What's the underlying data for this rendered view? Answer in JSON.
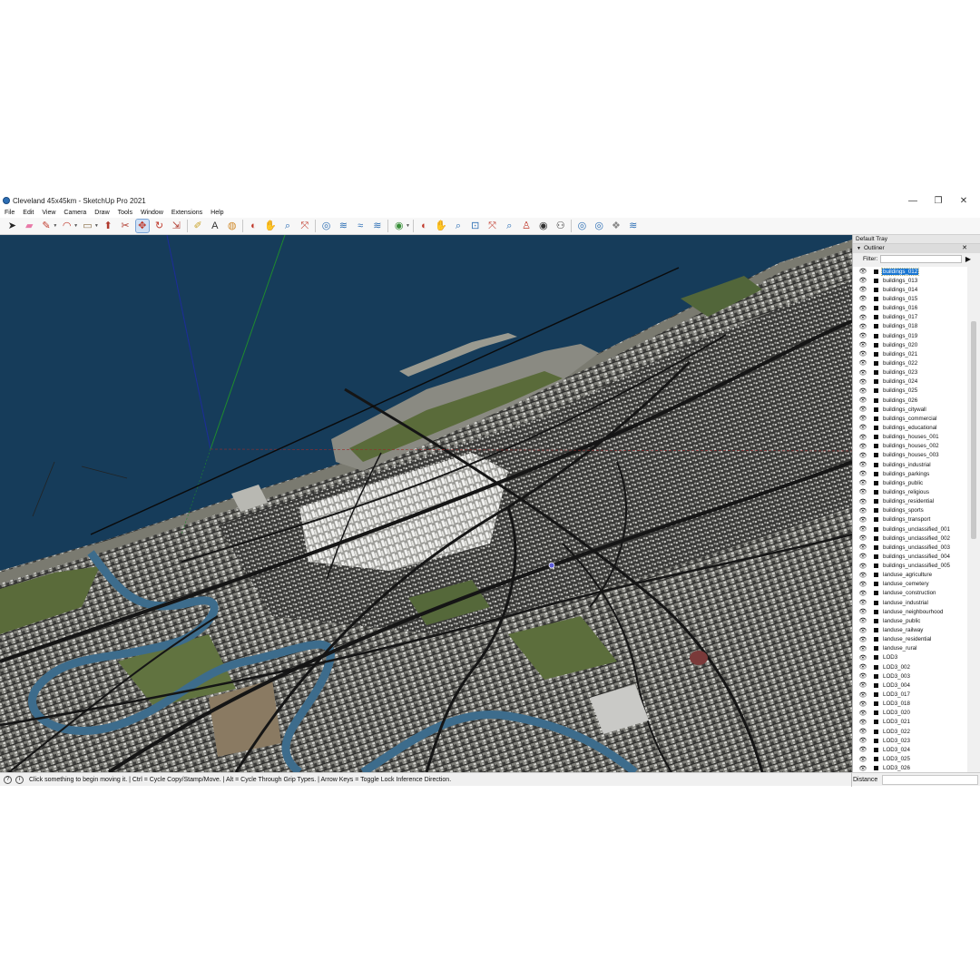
{
  "window": {
    "title": "Cleveland 45x45km - SketchUp Pro 2021",
    "minimize": "—",
    "maximize": "❐",
    "close": "✕"
  },
  "menu": [
    "File",
    "Edit",
    "View",
    "Camera",
    "Draw",
    "Tools",
    "Window",
    "Extensions",
    "Help"
  ],
  "toolbar": {
    "tools": [
      {
        "name": "select-icon",
        "glyph": "➤",
        "color": "#222"
      },
      {
        "name": "eraser-icon",
        "glyph": "▰",
        "color": "#e87aa8"
      },
      {
        "name": "pencil-icon",
        "glyph": "✎",
        "color": "#c0392b",
        "caret": true
      },
      {
        "name": "arc-icon",
        "glyph": "◠",
        "color": "#c0392b",
        "caret": true
      },
      {
        "name": "rectangle-icon",
        "glyph": "▭",
        "color": "#8a6f47",
        "caret": true
      },
      {
        "name": "push-pull-icon",
        "glyph": "⬆",
        "color": "#b03a2e"
      },
      {
        "name": "follow-me-icon",
        "glyph": "✂",
        "color": "#b03a2e"
      },
      {
        "name": "move-icon",
        "glyph": "✥",
        "color": "#c0392b",
        "active": true
      },
      {
        "name": "rotate-icon",
        "glyph": "↻",
        "color": "#c0392b"
      },
      {
        "name": "scale-icon",
        "glyph": "⇲",
        "color": "#b03a2e"
      },
      {
        "name": "tape-measure-icon",
        "glyph": "✐",
        "color": "#c9a227",
        "sep": true
      },
      {
        "name": "text-icon",
        "glyph": "A",
        "color": "#333"
      },
      {
        "name": "paint-bucket-icon",
        "glyph": "◍",
        "color": "#d08a2a"
      },
      {
        "name": "orbit-icon",
        "glyph": "◐",
        "color": "#c0392b",
        "sep": true
      },
      {
        "name": "pan-icon",
        "glyph": "✋",
        "color": "#d2a16b"
      },
      {
        "name": "zoom-icon",
        "glyph": "⌕",
        "color": "#2d6fb5"
      },
      {
        "name": "zoom-extents-icon",
        "glyph": "⤧",
        "color": "#c0392b"
      },
      {
        "name": "warehouse-icon",
        "glyph": "◎",
        "color": "#2d6fb5",
        "sep": true
      },
      {
        "name": "extension-warehouse-icon",
        "glyph": "≋",
        "color": "#2d6fb5"
      },
      {
        "name": "send-to-layout-icon",
        "glyph": "≈",
        "color": "#2d6fb5"
      },
      {
        "name": "extension-manager-icon",
        "glyph": "≋",
        "color": "#2d6fb5"
      },
      {
        "name": "account-icon",
        "glyph": "◉",
        "color": "#3a8f3a",
        "caret": true,
        "sep": true
      },
      {
        "name": "orbit-2-icon",
        "glyph": "◐",
        "color": "#c0392b",
        "sep": true
      },
      {
        "name": "pan-2-icon",
        "glyph": "✋",
        "color": "#d2a16b"
      },
      {
        "name": "zoom-2-icon",
        "glyph": "⌕",
        "color": "#2d6fb5"
      },
      {
        "name": "zoom-window-icon",
        "glyph": "⊡",
        "color": "#2d6fb5"
      },
      {
        "name": "zoom-extents-2-icon",
        "glyph": "⤧",
        "color": "#c0392b"
      },
      {
        "name": "previous-view-icon",
        "glyph": "⌕",
        "color": "#2d6fb5"
      },
      {
        "name": "position-camera-icon",
        "glyph": "♙",
        "color": "#c0392b"
      },
      {
        "name": "look-around-icon",
        "glyph": "◉",
        "color": "#333"
      },
      {
        "name": "walk-icon",
        "glyph": "⚇",
        "color": "#333"
      },
      {
        "name": "warehouse-2-icon",
        "glyph": "◎",
        "color": "#2d6fb5",
        "sep": true
      },
      {
        "name": "share-model-icon",
        "glyph": "◎",
        "color": "#2d6fb5"
      },
      {
        "name": "share-component-icon",
        "glyph": "❖",
        "color": "#888"
      },
      {
        "name": "extension-warehouse-2-icon",
        "glyph": "≋",
        "color": "#2d6fb5"
      }
    ]
  },
  "tray": {
    "title": "Default Tray",
    "panel_title": "Outliner",
    "close": "✕",
    "filter_label": "Filter:",
    "filter_value": "",
    "filter_button": "▶",
    "items": [
      {
        "label": "buildings_012",
        "selected": true
      },
      {
        "label": "buildings_013"
      },
      {
        "label": "buildings_014"
      },
      {
        "label": "buildings_015"
      },
      {
        "label": "buildings_016"
      },
      {
        "label": "buildings_017"
      },
      {
        "label": "buildings_018"
      },
      {
        "label": "buildings_019"
      },
      {
        "label": "buildings_020"
      },
      {
        "label": "buildings_021"
      },
      {
        "label": "buildings_022"
      },
      {
        "label": "buildings_023"
      },
      {
        "label": "buildings_024"
      },
      {
        "label": "buildings_025"
      },
      {
        "label": "buildings_026"
      },
      {
        "label": "buildings_citywall"
      },
      {
        "label": "buildings_commercial"
      },
      {
        "label": "buildings_educational"
      },
      {
        "label": "buildings_houses_001"
      },
      {
        "label": "buildings_houses_002"
      },
      {
        "label": "buildings_houses_003"
      },
      {
        "label": "buildings_industrial"
      },
      {
        "label": "buildings_parkings"
      },
      {
        "label": "buildings_public"
      },
      {
        "label": "buildings_religious"
      },
      {
        "label": "buildings_residential"
      },
      {
        "label": "buildings_sports"
      },
      {
        "label": "buildings_transport"
      },
      {
        "label": "buildings_unclassified_001"
      },
      {
        "label": "buildings_unclassified_002"
      },
      {
        "label": "buildings_unclassified_003"
      },
      {
        "label": "buildings_unclassified_004"
      },
      {
        "label": "buildings_unclassified_005"
      },
      {
        "label": "landuse_agriculture"
      },
      {
        "label": "landuse_cemetery"
      },
      {
        "label": "landuse_construction"
      },
      {
        "label": "landuse_industrial"
      },
      {
        "label": "landuse_neighbourhood"
      },
      {
        "label": "landuse_public"
      },
      {
        "label": "landuse_railway"
      },
      {
        "label": "landuse_residential"
      },
      {
        "label": "landuse_rural"
      },
      {
        "label": "LOD3"
      },
      {
        "label": "LOD3_002"
      },
      {
        "label": "LOD3_003"
      },
      {
        "label": "LOD3_004"
      },
      {
        "label": "LOD3_017"
      },
      {
        "label": "LOD3_018"
      },
      {
        "label": "LOD3_020"
      },
      {
        "label": "LOD3_021"
      },
      {
        "label": "LOD3_022"
      },
      {
        "label": "LOD3_023"
      },
      {
        "label": "LOD3_024"
      },
      {
        "label": "LOD3_025"
      },
      {
        "label": "LOD3_026"
      }
    ]
  },
  "status": {
    "message": "Click something to begin moving it. | Ctrl = Cycle Copy/Stamp/Move. | Alt = Cycle Through Grip Types. | Arrow Keys = Toggle Lock Inference Direction.",
    "info_icon": "?",
    "hint_icon": "i",
    "measurement_label": "Distance",
    "measurement_value": ""
  },
  "colors": {
    "water": "#163c5a",
    "land": "#8a8a80",
    "park": "#5a6b3a",
    "road": "#1a1a1a",
    "river": "#3d6c8c",
    "selection": "#1976d2"
  }
}
